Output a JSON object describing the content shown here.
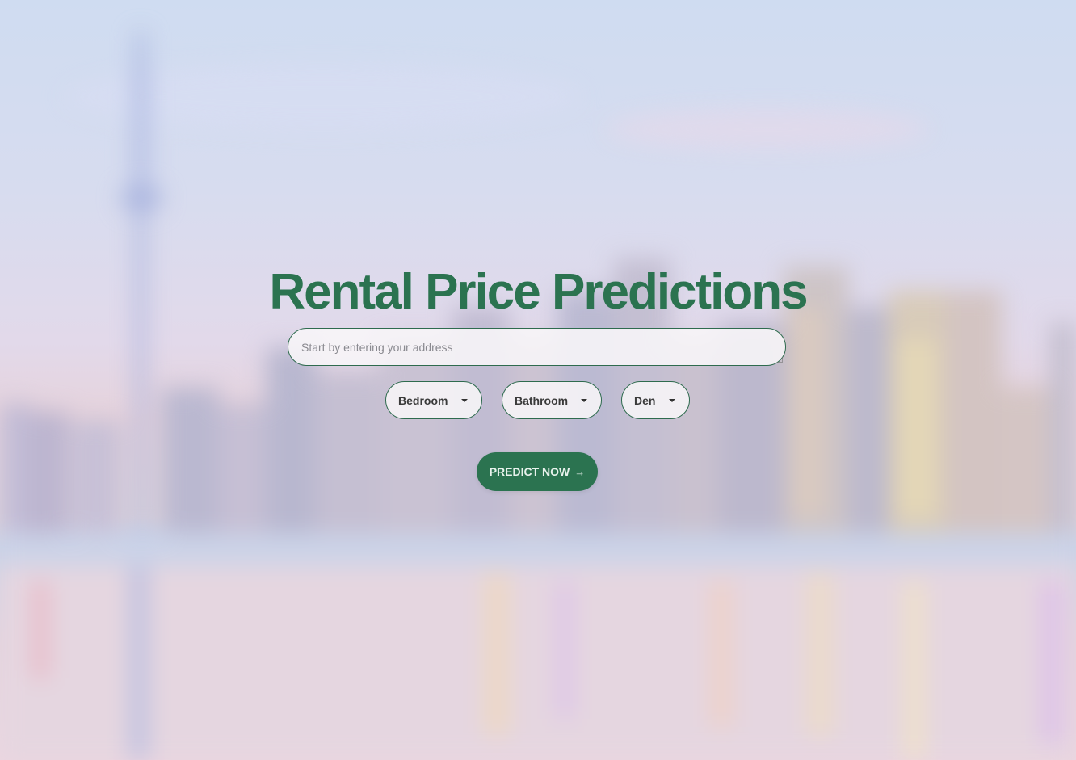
{
  "page": {
    "title": "Rental Price Predictions"
  },
  "address_input": {
    "placeholder": "Start by entering your address",
    "value": ""
  },
  "selects": {
    "bedroom": {
      "label": "Bedroom"
    },
    "bathroom": {
      "label": "Bathroom"
    },
    "den": {
      "label": "Den"
    }
  },
  "predict_button": {
    "label": "PREDICT NOW",
    "icon": "arrow-right-icon"
  },
  "colors": {
    "accent": "#2b7350",
    "border": "#2e6b4e"
  }
}
